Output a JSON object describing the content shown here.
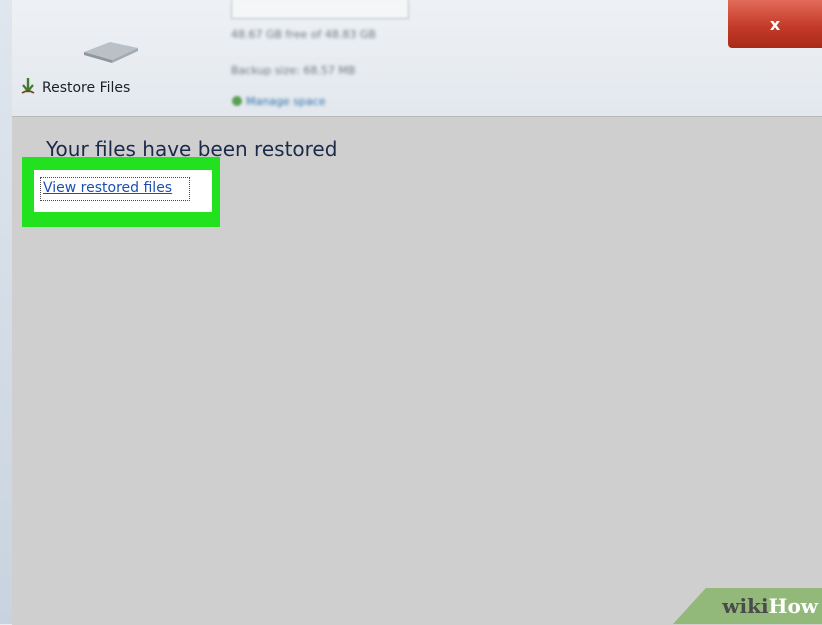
{
  "window": {
    "close_symbol": "x",
    "close_color": "#c43a28"
  },
  "header": {
    "free_space": "48.67 GB free of 48.83 GB",
    "backup_size": "Backup size: 68.57 MB",
    "manage_space": "Manage space",
    "restore_label": "Restore Files",
    "restore_icon": "restore-arrow-icon",
    "drive_icon": "drive-icon"
  },
  "main": {
    "heading": "Your files have been restored",
    "link_label": "View restored files",
    "highlight_color": "#22e11f",
    "panel_color": "#cfcfcf"
  },
  "watermark": {
    "wiki": "wiki",
    "how": "How"
  }
}
